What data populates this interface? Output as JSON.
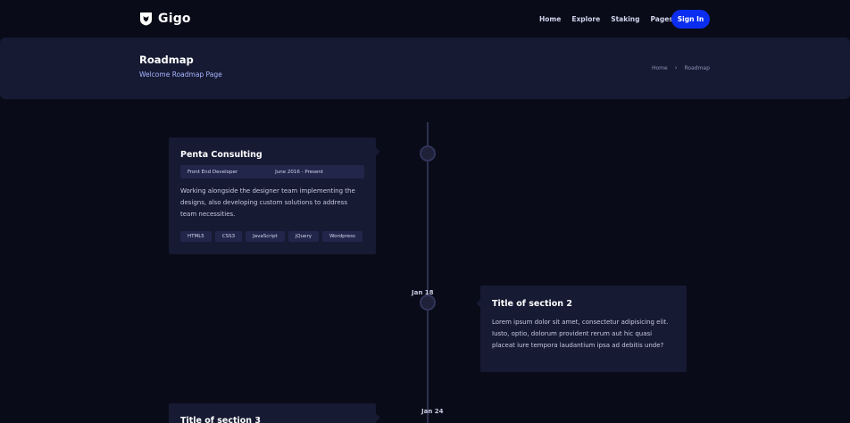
{
  "brand": {
    "name": "Gigo"
  },
  "nav": {
    "items": [
      "Home",
      "Explore",
      "Staking",
      "Pages"
    ],
    "signin": "Sign In"
  },
  "banner": {
    "title": "Roadmap",
    "subtitle": "Welcome Roadmap Page",
    "breadcrumb": [
      "Home",
      "Roadmap"
    ]
  },
  "timeline": {
    "entries": [
      {
        "title": "Penta Consulting",
        "role": "Front End Developer",
        "period": "June 2016 - Present",
        "body": "Working alongside the designer team implementing the designs, also developing custom solutions to address team necessities.",
        "tags": [
          "HTML5",
          "CSS3",
          "JavaScript",
          "jQuery",
          "Wordpress"
        ]
      },
      {
        "date": "Jan 18",
        "title": "Title of section 2",
        "body": "Lorem ipsum dolor sit amet, consectetur adipisicing elit. Iusto, optio, dolorum provident rerum aut hic quasi placeat iure tempora laudantium ipsa ad debitis unde?"
      },
      {
        "date": "Jan 24",
        "title": "Title of section 3"
      }
    ]
  },
  "colors": {
    "background": "#0a0b18",
    "panel": "#161a33",
    "accent": "#0a2df0",
    "subtitle": "#a9b6ff"
  }
}
